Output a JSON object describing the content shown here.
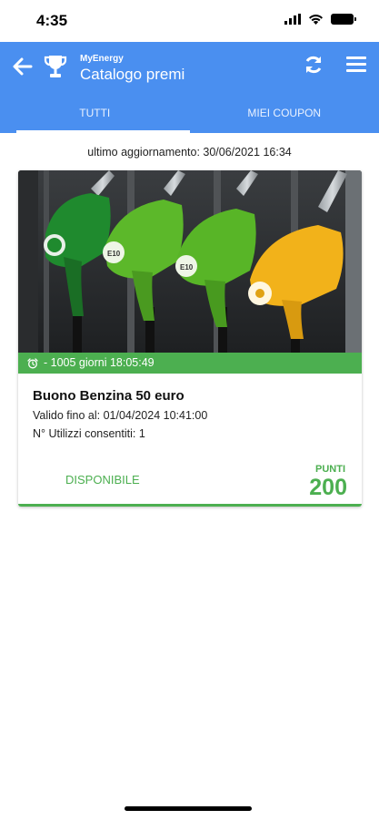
{
  "status_bar": {
    "time": "4:35"
  },
  "header": {
    "app_name": "MyEnergy",
    "title": "Catalogo premi"
  },
  "tabs": [
    {
      "label": "TUTTI",
      "active": true
    },
    {
      "label": "MIEI COUPON",
      "active": false
    }
  ],
  "last_update": "ultimo aggiornamento: 30/06/2021 16:34",
  "coupon": {
    "timer": "- 1005 giorni 18:05:49",
    "title": "Buono Benzina 50 euro",
    "valid_until": "Valido fino al: 01/04/2024 10:41:00",
    "uses": "N° Utilizzi consentiti: 1",
    "status": "DISPONIBILE",
    "points_label": "PUNTI",
    "points_value": "200",
    "nozzle_labels": [
      "E10",
      "E10"
    ]
  },
  "colors": {
    "header_blue": "#4a8ff0",
    "accent_green": "#4caf50"
  }
}
